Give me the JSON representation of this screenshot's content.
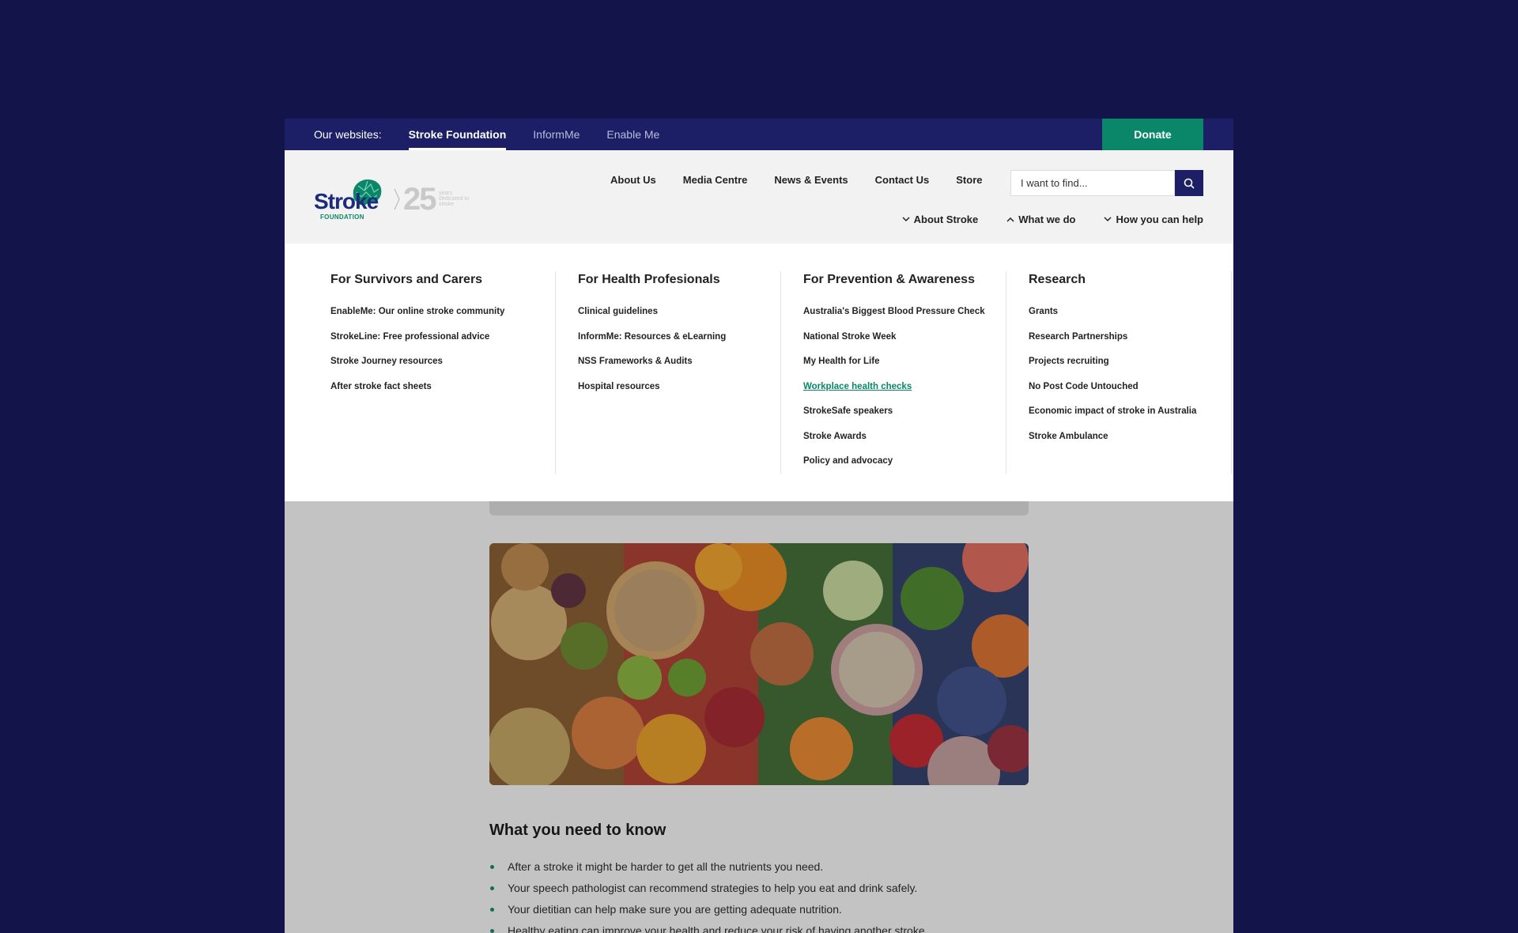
{
  "topbar": {
    "label": "Our websites:",
    "sites": [
      "Stroke Foundation",
      "InformMe",
      "Enable Me"
    ],
    "donate": "Donate"
  },
  "logo": {
    "brand": "Stroke",
    "sub": "FOUNDATION",
    "years": "25",
    "years_caption": "years dedicated to stroke"
  },
  "utility_nav": [
    "About Us",
    "Media Centre",
    "News & Events",
    "Contact Us",
    "Store"
  ],
  "search": {
    "placeholder": "I want to find..."
  },
  "main_nav": [
    {
      "label": "About Stroke",
      "icon": "chevron-down-icon"
    },
    {
      "label": "What we do",
      "icon": "chevron-up-icon"
    },
    {
      "label": "How you can help",
      "icon": "chevron-down-icon"
    }
  ],
  "mega_menu": [
    {
      "heading": "For Survivors and Carers",
      "links": [
        "EnableMe: Our online stroke community",
        "StrokeLine: Free professional advice",
        "Stroke Journey resources",
        "After stroke fact sheets"
      ]
    },
    {
      "heading": "For Health Profesionals",
      "links": [
        "Clinical guidelines",
        "InformMe: Resources & eLearning",
        "NSS Frameworks & Audits",
        "Hospital resources"
      ]
    },
    {
      "heading": "For Prevention & Awareness",
      "links": [
        "Australia's Biggest Blood Pressure Check",
        "National Stroke Week",
        "My Health for Life",
        "Workplace health checks",
        "StrokeSafe speakers",
        "Stroke Awards",
        "Policy and advocacy"
      ]
    },
    {
      "heading": "Research",
      "links": [
        "Grants",
        "Research Partnerships",
        "Projects recruiting",
        "No Post Code Untouched",
        "Economic impact of stroke in Australia",
        "Stroke Ambulance"
      ]
    }
  ],
  "content": {
    "heading": "What you need to know",
    "bullets": [
      "After a stroke it might be harder to get all the nutrients you need.",
      "Your speech pathologist can recommend strategies to help you eat and drink safely.",
      "Your dietitian can help make sure you are getting adequate nutrition.",
      "Healthy eating can improve your health and reduce your risk of having another stroke."
    ]
  },
  "colors": {
    "page_bg": "#13144a",
    "topbar": "#1c1f66",
    "accent_green": "#0a8768"
  }
}
